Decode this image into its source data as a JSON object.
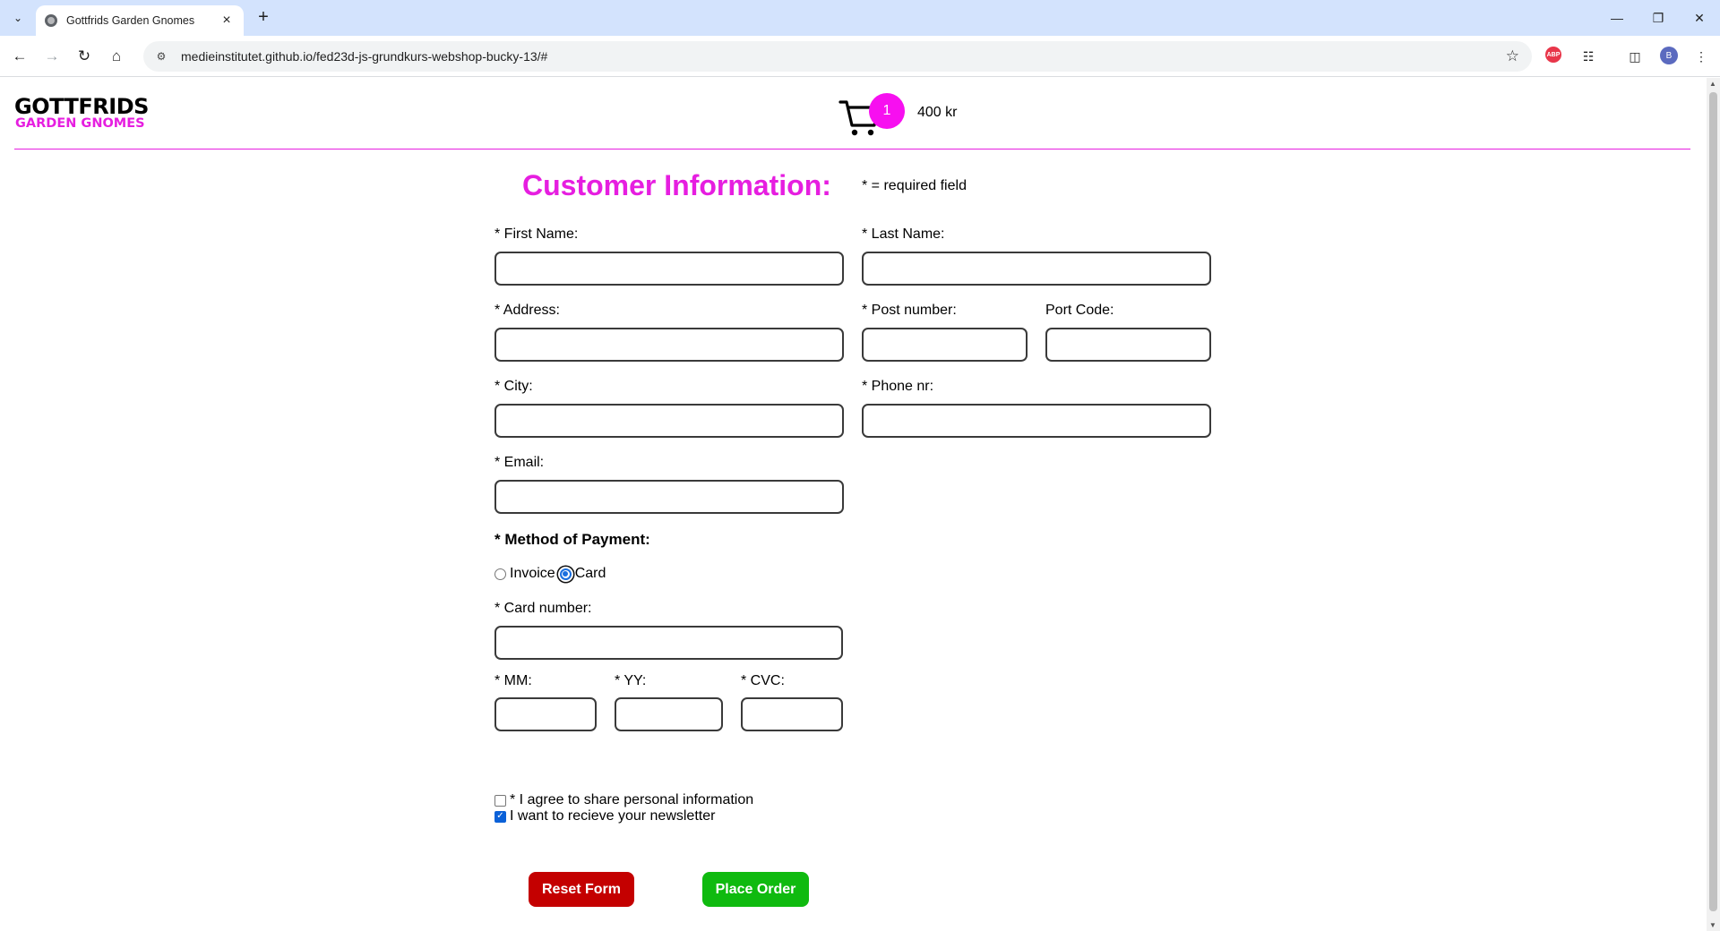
{
  "browser": {
    "tab_title": "Gottfrids Garden Gnomes",
    "url": "medieinstitutet.github.io/fed23d-js-grundkurs-webshop-bucky-13/#",
    "profile_initial": "B",
    "abp_label": "ABP"
  },
  "header": {
    "logo_top": "GOTTFRIDS",
    "logo_bottom": "GARDEN GNOMES",
    "cart_count": "1",
    "cart_total": "400 kr",
    "accent_color": "#e61ee0"
  },
  "form": {
    "heading": "Customer Information:",
    "required_note": "* = required field",
    "first_name_label": "* First Name:",
    "last_name_label": "* Last Name:",
    "address_label": "* Address:",
    "post_number_label": "* Post number:",
    "port_code_label": "Port Code:",
    "city_label": "* City:",
    "phone_label": "* Phone nr:",
    "email_label": "* Email:",
    "payment_title": "* Method of Payment:",
    "payment_options": [
      {
        "label": "Invoice",
        "selected": false
      },
      {
        "label": "Card",
        "selected": true
      }
    ],
    "card_number_label": "* Card number:",
    "mm_label": "* MM:",
    "yy_label": "* YY:",
    "cvc_label": "* CVC:",
    "consent_label": "* I agree to share personal information",
    "consent_checked": false,
    "newsletter_label": "I want to recieve your newsletter",
    "newsletter_checked": true,
    "reset_label": "Reset Form",
    "order_label": "Place Order",
    "reset_color": "#c40000",
    "order_color": "#0fba0f"
  }
}
